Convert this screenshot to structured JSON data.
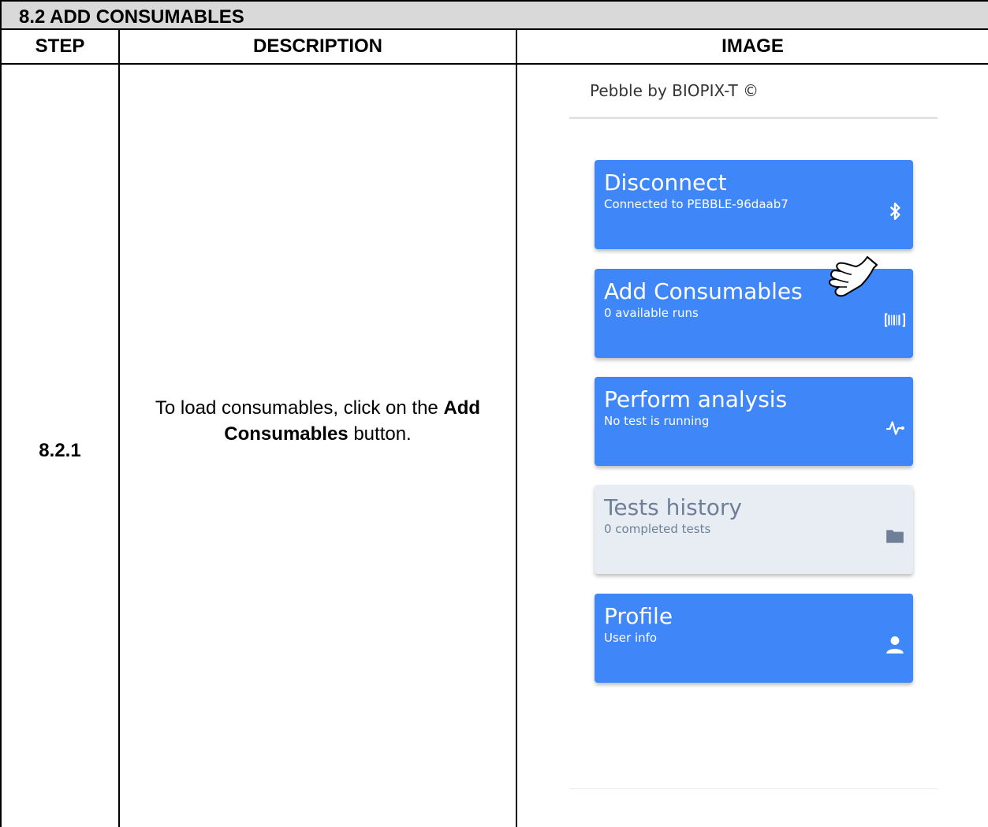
{
  "section": {
    "title": "8.2 ADD CONSUMABLES"
  },
  "table": {
    "headers": {
      "step": "STEP",
      "description": "DESCRIPTION",
      "image": "IMAGE"
    },
    "rows": [
      {
        "step": "8.2.1",
        "description_before": "To load consumables, click on the ",
        "description_bold": "Add Consumables",
        "description_after": " button."
      }
    ]
  },
  "app": {
    "title": "Pebble by BIOPIX-T ©",
    "cards": [
      {
        "title": "Disconnect",
        "subtitle": "Connected to PEBBLE-96daab7",
        "icon": "bluetooth-icon",
        "enabled": true
      },
      {
        "title": "Add Consumables",
        "subtitle": "0 available runs",
        "icon": "barcode-icon",
        "enabled": true
      },
      {
        "title": "Perform analysis",
        "subtitle": "No test is running",
        "icon": "pulse-icon",
        "enabled": true
      },
      {
        "title": "Tests history",
        "subtitle": "0 completed tests",
        "icon": "folder-icon",
        "enabled": false
      },
      {
        "title": "Profile",
        "subtitle": "User info",
        "icon": "user-icon",
        "enabled": true
      }
    ],
    "colors": {
      "card": "#3f86f8",
      "card_disabled": "#e8edf4",
      "disabled_text": "#6f7f98"
    }
  }
}
